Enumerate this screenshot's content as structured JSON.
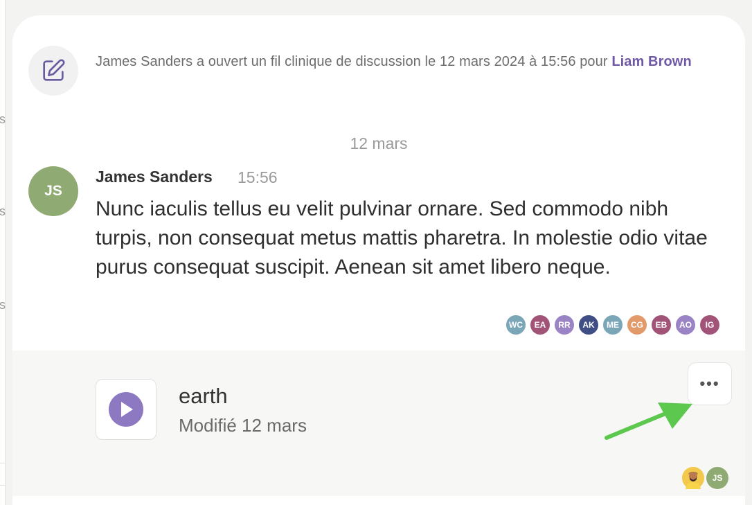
{
  "event": {
    "text": "James Sanders a ouvert un fil clinique de discussion le 12 mars 2024 à 15:56 pour ",
    "patient_link": "Liam Brown",
    "icon": "edit-square-icon"
  },
  "date_separator": "12 mars",
  "message": {
    "author_initials": "JS",
    "author_name": "James Sanders",
    "time": "15:56",
    "body": "Nunc iaculis tellus eu velit pulvinar ornare. Sed commodo nibh turpis, non consequat metus mattis pharetra. In molestie odio vitae purus consequat suscipit. Aenean sit amet libero neque."
  },
  "readers": [
    {
      "initials": "WC",
      "color": "#7aa6b8"
    },
    {
      "initials": "EA",
      "color": "#a25378"
    },
    {
      "initials": "RR",
      "color": "#9a84c6"
    },
    {
      "initials": "AK",
      "color": "#3f4f86"
    },
    {
      "initials": "ME",
      "color": "#7aa6b8"
    },
    {
      "initials": "CG",
      "color": "#e39a6b"
    },
    {
      "initials": "EB",
      "color": "#a25378"
    },
    {
      "initials": "AO",
      "color": "#9a84c6"
    },
    {
      "initials": "IG",
      "color": "#a25378"
    }
  ],
  "attachment": {
    "name": "earth",
    "modified": "Modifié 12 mars",
    "type_icon": "play-icon",
    "more_label": "•••"
  },
  "viewers": [
    {
      "initials": "",
      "color": "#f2c94c",
      "icon": "user-photo-avatar"
    },
    {
      "initials": "JS",
      "color": "#8faa73"
    }
  ],
  "colors": {
    "accent_purple": "#7058a8",
    "arrow_green": "#5cc94e"
  }
}
